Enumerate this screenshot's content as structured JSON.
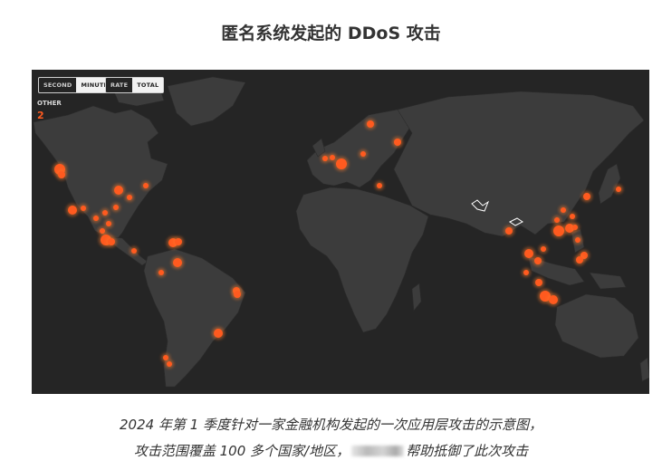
{
  "title": "匿名系统发起的 DDoS 攻击",
  "map": {
    "toggles": {
      "time": [
        {
          "label": "SECOND",
          "active": false
        },
        {
          "label": "MINUTE",
          "active": true
        }
      ],
      "mode": [
        {
          "label": "RATE",
          "active": false
        },
        {
          "label": "TOTAL",
          "active": true
        }
      ]
    },
    "other_label": "OTHER",
    "other_count": "2",
    "colors": {
      "background": "#252525",
      "land": "#3c3c3c",
      "hotspot": "#ff5a1f",
      "glow": "#ff7a2a"
    }
  },
  "caption": {
    "line1": "2024 年第 1 季度针对一家金融机构发起的一次应用层攻击的示意图，",
    "line2_before": "攻击范围覆盖 100 多个国家/地区，",
    "line2_after": "帮助抵御了此次攻击"
  }
}
